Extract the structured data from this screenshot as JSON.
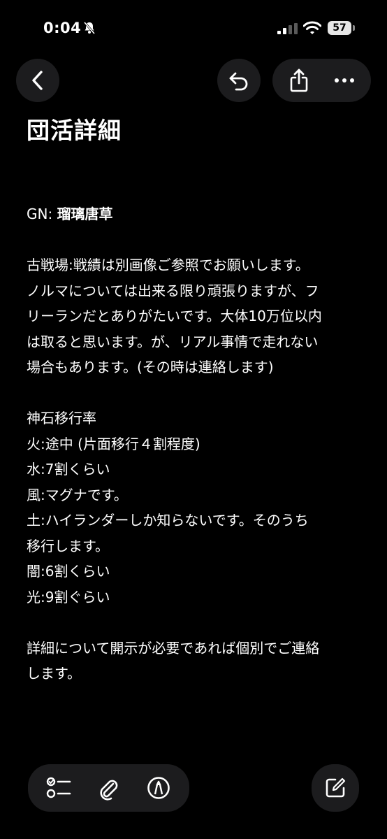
{
  "status_bar": {
    "time": "0:04",
    "battery": "57"
  },
  "toolbar": {
    "back_icon": "chevron-left-icon",
    "undo_icon": "undo-icon",
    "share_icon": "share-icon",
    "more_icon": "ellipsis-icon"
  },
  "note": {
    "title": "団活詳細",
    "gn_label": "GN: ",
    "gn_value": "瑠璃唐草",
    "lines": [
      "古戦場:戦績は別画像ご参照でお願いします。",
      "ノルマについては出来る限り頑張りますが、フ",
      "リーランだとありがたいです。大体10万位以内",
      "は取ると思います。が、リアル事情で走れない",
      "場合もあります。(その時は連絡します)"
    ],
    "lines2": [
      "神石移行率",
      "火:途中 (片面移行４割程度)",
      "水:7割くらい",
      "風:マグナです。",
      "土:ハイランダーしか知らないです。そのうち",
      "移行します。",
      "闇:6割くらい",
      "光:9割ぐらい"
    ],
    "lines3": [
      "詳細について開示が必要であれば個別でご連絡",
      "します。"
    ]
  },
  "bottom_bar": {
    "checklist_icon": "checklist-icon",
    "attach_icon": "paperclip-icon",
    "markup_icon": "pen-circle-icon",
    "compose_icon": "compose-icon"
  }
}
